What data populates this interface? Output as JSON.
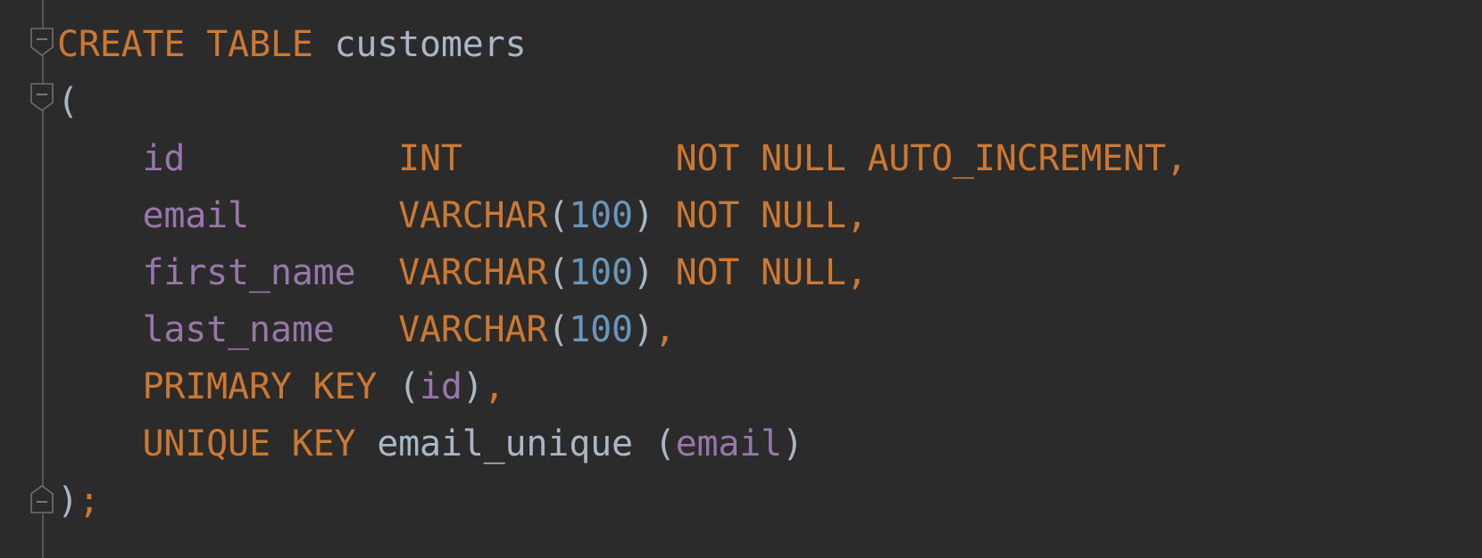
{
  "editor": {
    "language": "SQL",
    "background": "#2b2b2b",
    "colors": {
      "keyword": "#cc7832",
      "column": "#9876aa",
      "number": "#6897bb",
      "identifier": "#a9b7c6"
    },
    "fold_markers": [
      "fold-open-icon",
      "fold-open-icon",
      "fold-close-icon"
    ],
    "lines": [
      {
        "tokens": [
          {
            "t": "kw",
            "text": "CREATE TABLE"
          },
          {
            "t": "sp",
            "text": " "
          },
          {
            "t": "id",
            "text": "customers"
          }
        ]
      },
      {
        "tokens": [
          {
            "t": "punc",
            "text": "("
          }
        ]
      },
      {
        "tokens": [
          {
            "t": "sp",
            "text": "    "
          },
          {
            "t": "col",
            "text": "id"
          },
          {
            "t": "sp",
            "text": "          "
          },
          {
            "t": "kw",
            "text": "INT"
          },
          {
            "t": "sp",
            "text": "          "
          },
          {
            "t": "kw",
            "text": "NOT NULL AUTO_INCREMENT,"
          }
        ]
      },
      {
        "tokens": [
          {
            "t": "sp",
            "text": "    "
          },
          {
            "t": "col",
            "text": "email"
          },
          {
            "t": "sp",
            "text": "       "
          },
          {
            "t": "kw",
            "text": "VARCHAR"
          },
          {
            "t": "punc",
            "text": "("
          },
          {
            "t": "num",
            "text": "100"
          },
          {
            "t": "punc",
            "text": ")"
          },
          {
            "t": "sp",
            "text": " "
          },
          {
            "t": "kw",
            "text": "NOT NULL,"
          }
        ]
      },
      {
        "tokens": [
          {
            "t": "sp",
            "text": "    "
          },
          {
            "t": "col",
            "text": "first_name"
          },
          {
            "t": "sp",
            "text": "  "
          },
          {
            "t": "kw",
            "text": "VARCHAR"
          },
          {
            "t": "punc",
            "text": "("
          },
          {
            "t": "num",
            "text": "100"
          },
          {
            "t": "punc",
            "text": ")"
          },
          {
            "t": "sp",
            "text": " "
          },
          {
            "t": "kw",
            "text": "NOT NULL,"
          }
        ]
      },
      {
        "tokens": [
          {
            "t": "sp",
            "text": "    "
          },
          {
            "t": "col",
            "text": "last_name"
          },
          {
            "t": "sp",
            "text": "   "
          },
          {
            "t": "kw",
            "text": "VARCHAR"
          },
          {
            "t": "punc",
            "text": "("
          },
          {
            "t": "num",
            "text": "100"
          },
          {
            "t": "punc",
            "text": ")"
          },
          {
            "t": "kw",
            "text": ","
          }
        ]
      },
      {
        "tokens": [
          {
            "t": "sp",
            "text": "    "
          },
          {
            "t": "kw",
            "text": "PRIMARY KEY"
          },
          {
            "t": "sp",
            "text": " "
          },
          {
            "t": "punc",
            "text": "("
          },
          {
            "t": "col",
            "text": "id"
          },
          {
            "t": "punc",
            "text": ")"
          },
          {
            "t": "kw",
            "text": ","
          }
        ]
      },
      {
        "tokens": [
          {
            "t": "sp",
            "text": "    "
          },
          {
            "t": "kw",
            "text": "UNIQUE KEY"
          },
          {
            "t": "sp",
            "text": " "
          },
          {
            "t": "id",
            "text": "email_unique"
          },
          {
            "t": "sp",
            "text": " "
          },
          {
            "t": "punc",
            "text": "("
          },
          {
            "t": "col",
            "text": "email"
          },
          {
            "t": "punc",
            "text": ")"
          }
        ]
      },
      {
        "tokens": [
          {
            "t": "punc",
            "text": ")"
          },
          {
            "t": "semi",
            "text": ";"
          }
        ]
      }
    ]
  }
}
